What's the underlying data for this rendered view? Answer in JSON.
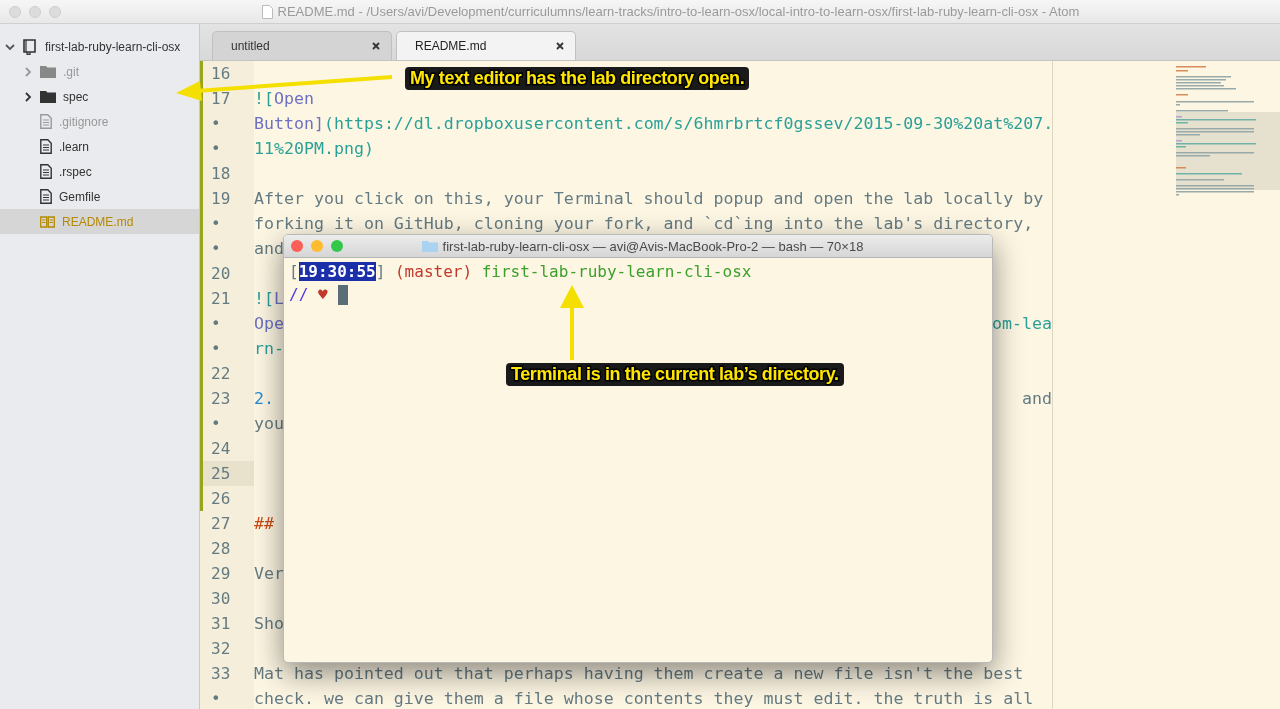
{
  "window": {
    "title": "README.md - /Users/avi/Development/curriculumns/learn-tracks/intro-to-learn-osx/local-intro-to-learn-osx/first-lab-ruby-learn-cli-osx - Atom"
  },
  "tree": {
    "label": "first-lab-ruby-learn-cli-osx",
    "expanded": true,
    "children": [
      {
        "kind": "folder",
        "label": ".git",
        "expanded": false,
        "ignored": true,
        "selected": false
      },
      {
        "kind": "folder",
        "label": "spec",
        "expanded": false,
        "ignored": false,
        "selected": false
      },
      {
        "kind": "file",
        "label": ".gitignore",
        "ignored": true,
        "selected": false
      },
      {
        "kind": "file",
        "label": ".learn",
        "ignored": false,
        "selected": false
      },
      {
        "kind": "file",
        "label": ".rspec",
        "ignored": false,
        "selected": false
      },
      {
        "kind": "file",
        "label": "Gemfile",
        "ignored": false,
        "selected": false
      },
      {
        "kind": "readme",
        "label": "README.md",
        "ignored": false,
        "selected": true
      }
    ]
  },
  "tabs": [
    {
      "label": "untitled",
      "selected": false
    },
    {
      "label": "README.md",
      "selected": true
    }
  ],
  "editor": {
    "rows": [
      {
        "gutter": "16",
        "modified": true,
        "current": false,
        "segments": []
      },
      {
        "gutter": "17",
        "modified": true,
        "current": false,
        "segments": [
          {
            "text": "![",
            "kind": "url"
          },
          {
            "text": "Open",
            "kind": "link_text"
          }
        ]
      },
      {
        "gutter": "•",
        "modified": true,
        "current": false,
        "segments": [
          {
            "text": "Button]",
            "kind": "link_text"
          },
          {
            "text": "(https://dl.dropboxusercontent.com/s/6hmrbrtcf0gssev/2015-09-30%20at%207.",
            "kind": "url"
          }
        ]
      },
      {
        "gutter": "•",
        "modified": true,
        "current": false,
        "segments": [
          {
            "text": "11%20PM.png)",
            "kind": "url"
          }
        ]
      },
      {
        "gutter": "18",
        "modified": true,
        "current": false,
        "segments": []
      },
      {
        "gutter": "19",
        "modified": true,
        "current": false,
        "segments": [
          {
            "text": "After you click on this, your Terminal should popup and open the lab locally by",
            "kind": "text"
          }
        ]
      },
      {
        "gutter": "•",
        "modified": true,
        "current": false,
        "segments": [
          {
            "text": "forking it on GitHub, cloning your fork, and `cd`ing into the lab's directory,",
            "kind": "text"
          }
        ]
      },
      {
        "gutter": "•",
        "modified": true,
        "current": false,
        "segments": [
          {
            "text": "and",
            "kind": "text"
          }
        ]
      },
      {
        "gutter": "20",
        "modified": true,
        "current": false,
        "segments": []
      },
      {
        "gutter": "21",
        "modified": true,
        "current": false,
        "segments": [
          {
            "text": "![",
            "kind": "url"
          },
          {
            "text": "L",
            "kind": "link_text"
          }
        ]
      },
      {
        "gutter": "•",
        "modified": true,
        "current": false,
        "segments": [
          {
            "text": "Ope",
            "kind": "link_text"
          }
        ],
        "trailing": [
          {
            "text": "om-lea",
            "kind": "url"
          }
        ]
      },
      {
        "gutter": "•",
        "modified": true,
        "current": false,
        "segments": [
          {
            "text": "rn-",
            "kind": "url"
          }
        ]
      },
      {
        "gutter": "22",
        "modified": true,
        "current": false,
        "segments": []
      },
      {
        "gutter": "23",
        "modified": true,
        "current": false,
        "segments": [
          {
            "text": "2.",
            "kind": "list"
          }
        ],
        "trailing": [
          {
            "text": "and",
            "kind": "text"
          }
        ]
      },
      {
        "gutter": "•",
        "modified": true,
        "current": false,
        "segments": [
          {
            "text": "you",
            "kind": "text"
          }
        ]
      },
      {
        "gutter": "24",
        "modified": true,
        "current": false,
        "segments": []
      },
      {
        "gutter": "25",
        "modified": true,
        "current": true,
        "segments": []
      },
      {
        "gutter": "26",
        "modified": true,
        "current": false,
        "segments": []
      },
      {
        "gutter": "27",
        "modified": false,
        "current": false,
        "segments": [
          {
            "text": "##",
            "kind": "heading"
          }
        ]
      },
      {
        "gutter": "28",
        "modified": false,
        "current": false,
        "segments": []
      },
      {
        "gutter": "29",
        "modified": false,
        "current": false,
        "segments": [
          {
            "text": "Ver",
            "kind": "text"
          }
        ]
      },
      {
        "gutter": "30",
        "modified": false,
        "current": false,
        "segments": []
      },
      {
        "gutter": "31",
        "modified": false,
        "current": false,
        "segments": [
          {
            "text": "Sho",
            "kind": "text"
          }
        ]
      },
      {
        "gutter": "32",
        "modified": false,
        "current": false,
        "segments": []
      },
      {
        "gutter": "33",
        "modified": false,
        "current": false,
        "segments": [
          {
            "text": "Mat has pointed out that perhaps having them create a new file isn't the best",
            "kind": "text"
          }
        ]
      },
      {
        "gutter": "•",
        "modified": false,
        "current": false,
        "segments": [
          {
            "text": "check. we can give them a file whose contents they must edit. the truth is all",
            "kind": "text"
          }
        ]
      }
    ]
  },
  "terminal": {
    "title": "first-lab-ruby-learn-cli-osx — avi@Avis-MacBook-Pro-2 — bash — 70×18",
    "lines": [
      [
        {
          "text": "[",
          "kind": "plain"
        },
        {
          "text": "19:30:55",
          "kind": "time"
        },
        {
          "text": "]",
          "kind": "plain"
        },
        {
          "text": " (master)",
          "kind": "branch"
        },
        {
          "text": " first-lab-ruby-learn-cli-osx",
          "kind": "path"
        }
      ],
      [
        {
          "text": "//",
          "kind": "slashes"
        },
        {
          "text": " ♥",
          "kind": "heart"
        }
      ]
    ]
  },
  "annotations": [
    {
      "text": "My text editor has the lab directory open.",
      "kind": "left"
    },
    {
      "text": "Terminal is in the current lab’s directory.",
      "kind": "up"
    }
  ]
}
